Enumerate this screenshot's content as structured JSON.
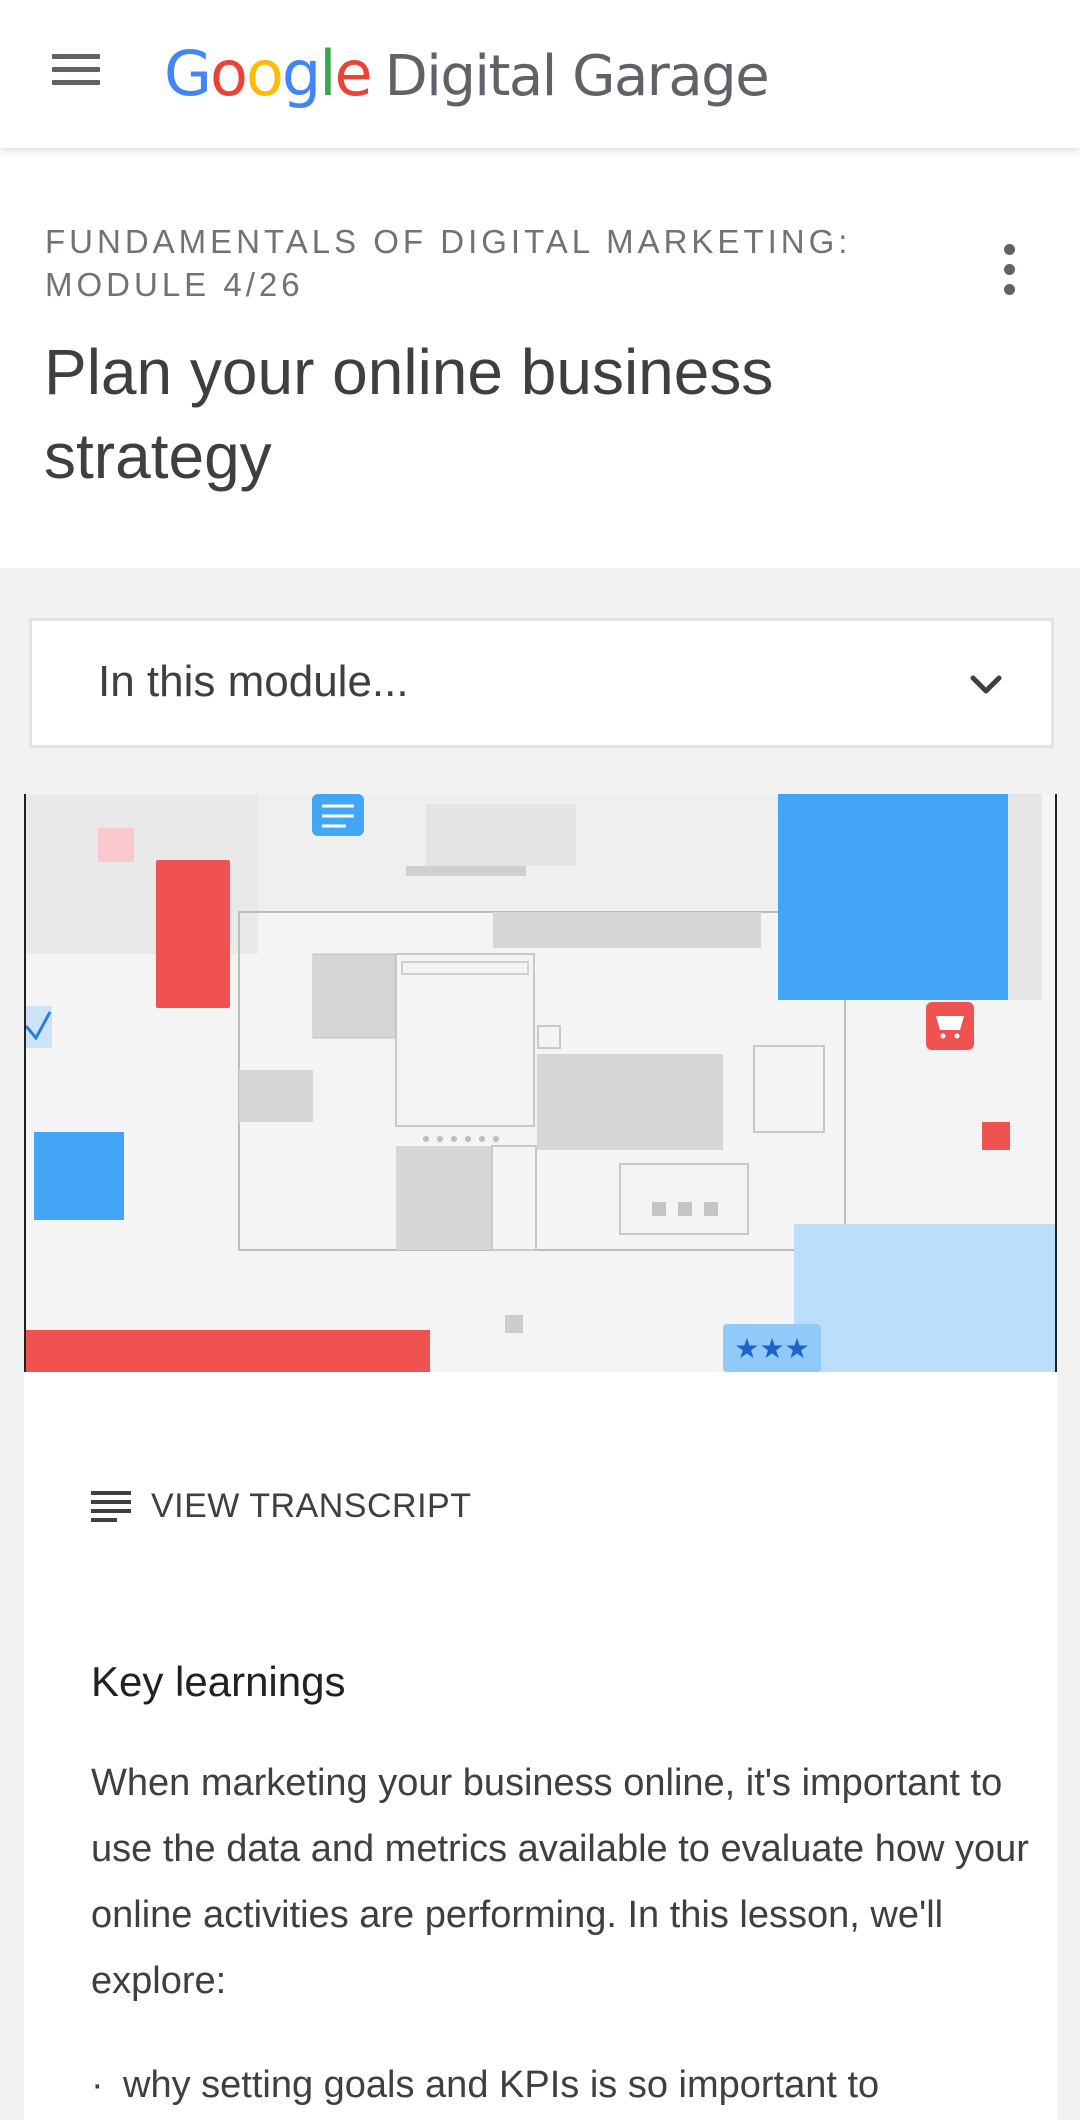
{
  "header": {
    "menu_icon": "hamburger-menu-icon",
    "brand_letters": [
      "G",
      "o",
      "o",
      "g",
      "l",
      "e"
    ],
    "brand_colors": [
      "#4285f4",
      "#ea4335",
      "#fbbc05",
      "#4285f4",
      "#34a853",
      "#ea4335"
    ],
    "product_name": "Digital Garage"
  },
  "course": {
    "eyebrow": "FUNDAMENTALS OF DIGITAL MARKETING: MODULE 4/26",
    "title": "Plan your online business strategy",
    "more_icon": "more-vert-icon"
  },
  "module_dropdown": {
    "label": "In this module...",
    "icon": "chevron-down-icon"
  },
  "video": {
    "icons": [
      "checkmark-icon",
      "shopping-cart-icon",
      "document-icon",
      "star-rating-icon"
    ],
    "colors": {
      "red": "#f05151",
      "blue": "#42a5f5",
      "light_blue": "#bbdefb",
      "pink": "#f8c8cc",
      "gray": "#d6d6d6"
    }
  },
  "transcript": {
    "icon": "transcript-lines-icon",
    "label": "VIEW TRANSCRIPT"
  },
  "key_learnings": {
    "heading": "Key learnings",
    "body": "When marketing your business online, it's important to use the data and metrics available to evaluate how your online activities are performing. In this lesson, we'll explore:",
    "items": [
      "why setting goals and KPIs is so important to"
    ]
  }
}
